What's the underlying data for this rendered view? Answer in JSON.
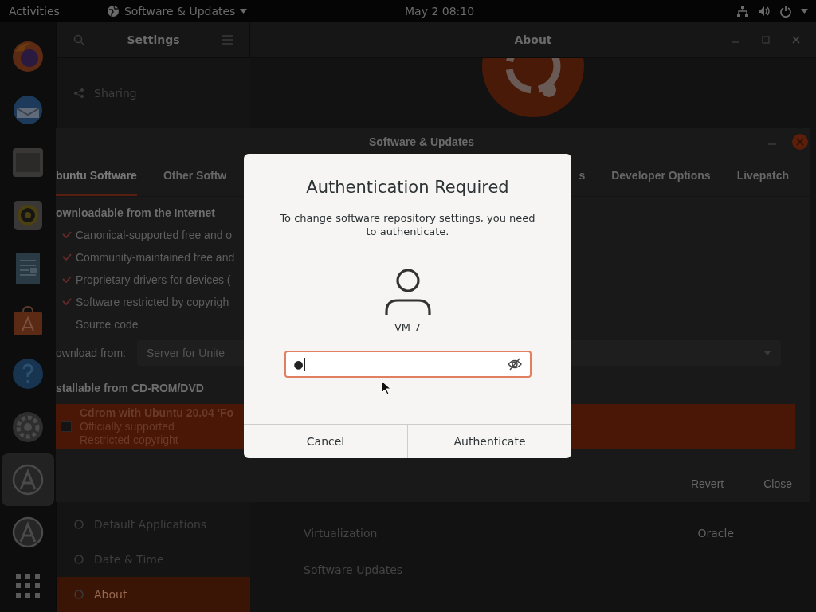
{
  "top_bar": {
    "activities": "Activities",
    "app_menu": "Software & Updates",
    "clock": "May 2  08:10"
  },
  "dock": {
    "apps": [
      {
        "kind": "firefox",
        "active": false
      },
      {
        "kind": "mail",
        "active": false
      },
      {
        "kind": "files",
        "active": false
      },
      {
        "kind": "music",
        "active": false
      },
      {
        "kind": "document",
        "active": false
      },
      {
        "kind": "store",
        "active": false
      },
      {
        "kind": "help",
        "active": false
      },
      {
        "kind": "settings",
        "active": false
      },
      {
        "kind": "updater",
        "active": true
      },
      {
        "kind": "updater",
        "active": false
      },
      {
        "kind": "grid",
        "active": false
      }
    ]
  },
  "settings_window": {
    "title": "Settings",
    "page_title": "About",
    "sidebar_upper": [
      {
        "label": "Sharing",
        "selected": false
      }
    ],
    "sidebar_lower": [
      {
        "label": "Default Applications",
        "selected": false
      },
      {
        "label": "Date & Time",
        "selected": false
      },
      {
        "label": "About",
        "selected": true
      }
    ],
    "rows": [
      {
        "label": "Virtualization",
        "value": "Oracle"
      },
      {
        "label": "Software Updates"
      }
    ]
  },
  "software_updates_window": {
    "title": "Software & Updates",
    "tabs": [
      {
        "label": "buntu Software",
        "selected": true
      },
      {
        "label": "Other Softw",
        "selected": false
      },
      {
        "label": "s",
        "selected": false
      },
      {
        "label": "Developer Options",
        "selected": false
      },
      {
        "label": "Livepatch",
        "selected": false
      }
    ],
    "internet_heading": "ownloadable from the Internet",
    "sources": [
      {
        "label": "Canonical-supported free and o",
        "checked": true
      },
      {
        "label": "Community-maintained free and",
        "checked": true
      },
      {
        "label": "Proprietary drivers for devices (",
        "checked": true
      },
      {
        "label": "Software restricted by copyrigh",
        "checked": true
      },
      {
        "label": "Source code",
        "checked": false
      }
    ],
    "download_label": "ownload from:",
    "download_server": "Server for Unite",
    "cdrom_heading": "stallable from CD-ROM/DVD",
    "cdrom": {
      "name": "Cdrom with Ubuntu 20.04 'Fo",
      "lines": [
        "Officially supported",
        "Restricted copyright"
      ],
      "checked": false
    },
    "buttons": [
      "Revert",
      "Close"
    ]
  },
  "dialog": {
    "title": "Authentication Required",
    "message": "To change software repository settings, you need to authenticate.",
    "user": "VM-7",
    "password": "●",
    "buttons": [
      "Cancel",
      "Authenticate"
    ]
  }
}
